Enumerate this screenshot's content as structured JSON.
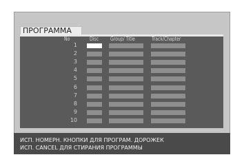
{
  "screen": {
    "title": "ПРОГРАММА",
    "columns": {
      "no": "No",
      "disc": "Disc",
      "group_title": "Group/ Title",
      "track_chapter": "Track/Chapter"
    },
    "rows": [
      "1",
      "2",
      "3",
      "4",
      "5",
      "6",
      "7",
      "8",
      "9",
      "10"
    ],
    "selected_row": 1,
    "messages": [
      "ИСП. НОМЕРН. КНОПКИ ДЛЯ ПРОГРАМ. ДОРОЖЕК",
      "ИСП. CANCEL ДЛЯ СТИРАНИЯ ПРОГРАММЫ"
    ]
  }
}
